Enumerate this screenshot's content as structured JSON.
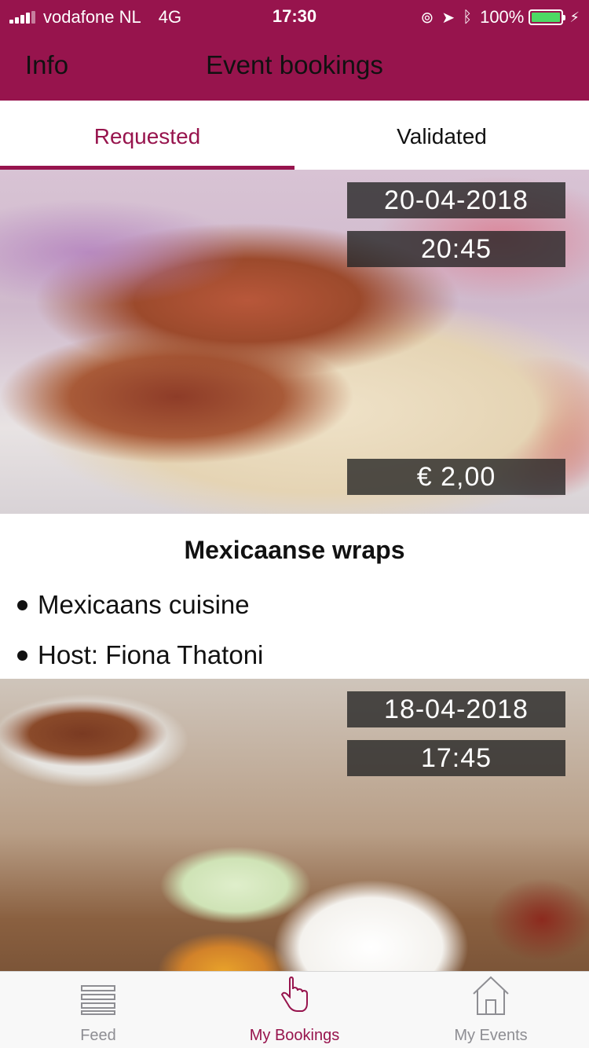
{
  "status_bar": {
    "carrier": "vodafone NL",
    "network": "4G",
    "time": "17:30",
    "battery_percent": "100%",
    "battery_level": 1.0
  },
  "nav": {
    "left_label": "Info",
    "title": "Event bookings"
  },
  "tabs": [
    {
      "label": "Requested",
      "active": true
    },
    {
      "label": "Validated",
      "active": false
    }
  ],
  "events": [
    {
      "date": "20-04-2018",
      "time": "20:45",
      "price": "€ 2,00",
      "title": "Mexicaanse wraps",
      "details": [
        "Mexicaans cuisine",
        "Host: Fiona Thatoni"
      ]
    },
    {
      "date": "18-04-2018",
      "time": "17:45"
    }
  ],
  "tab_bar": {
    "items": [
      {
        "label": "Feed",
        "icon": "list-icon",
        "active": false
      },
      {
        "label": "My Bookings",
        "icon": "hand-pointer-icon",
        "active": true
      },
      {
        "label": "My Events",
        "icon": "house-icon",
        "active": false
      }
    ]
  },
  "colors": {
    "brand": "#97144d",
    "tab_inactive": "#8e8e93",
    "battery": "#4cd964"
  }
}
